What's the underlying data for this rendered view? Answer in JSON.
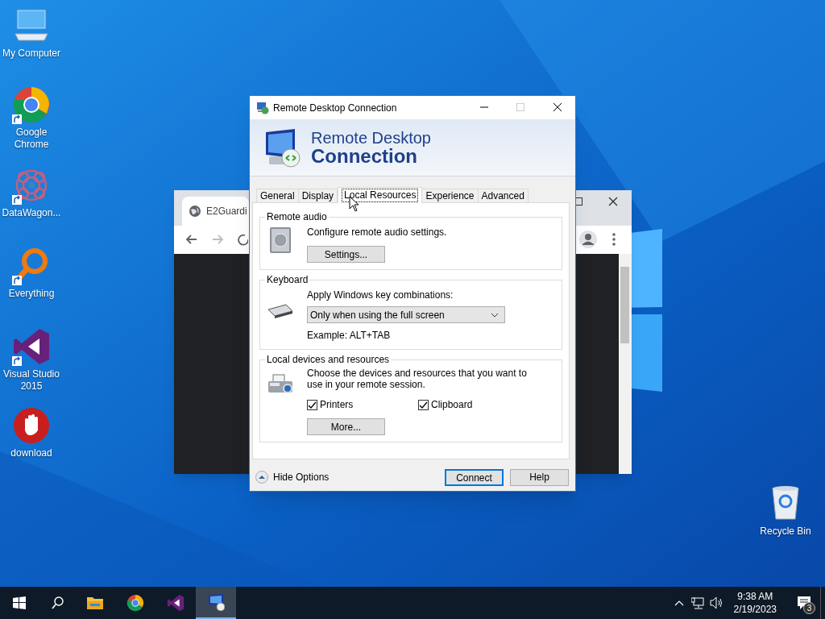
{
  "desktop_icons": [
    {
      "kind": "computer",
      "label": "My Computer",
      "shortcut": false
    },
    {
      "kind": "chrome",
      "label": "Google Chrome",
      "shortcut": true
    },
    {
      "kind": "datawagon",
      "label": "DataWagon...",
      "shortcut": true
    },
    {
      "kind": "everything",
      "label": "Everything",
      "shortcut": true
    },
    {
      "kind": "visualstudio",
      "label": "Visual Studio 2015",
      "shortcut": true
    },
    {
      "kind": "stop",
      "label": "download",
      "shortcut": false
    }
  ],
  "recycle_bin": {
    "label": "Recycle Bin"
  },
  "browser_window": {
    "tab_title": "E2Guardi"
  },
  "dialog": {
    "title": "Remote Desktop Connection",
    "banner": {
      "line_1": "Remote Desktop",
      "line_2": "Connection"
    },
    "tabs": [
      {
        "label": "General",
        "selected": false
      },
      {
        "label": "Display",
        "selected": false
      },
      {
        "label": "Local Resources",
        "selected": true
      },
      {
        "label": "Experience",
        "selected": false
      },
      {
        "label": "Advanced",
        "selected": false
      }
    ],
    "remote_audio": {
      "title": "Remote audio",
      "description": "Configure remote audio settings.",
      "button": "Settings..."
    },
    "keyboard": {
      "title": "Keyboard",
      "label": "Apply Windows key combinations:",
      "dropdown_value": "Only when using the full screen",
      "example": "Example: ALT+TAB"
    },
    "local_devices": {
      "title": "Local devices and resources",
      "description": "Choose the devices and resources that you want to use in your remote session.",
      "checkboxes": [
        {
          "label": "Printers",
          "checked": true
        },
        {
          "label": "Clipboard",
          "checked": true
        }
      ],
      "button": "More..."
    },
    "footer": {
      "toggle": "Hide Options",
      "buttons": [
        {
          "label": "Connect",
          "default": true
        },
        {
          "label": "Help",
          "default": false
        }
      ]
    }
  },
  "taskbar": {
    "apps": [
      {
        "kind": "explorer",
        "active": false
      },
      {
        "kind": "chrome",
        "active": false
      },
      {
        "kind": "visualstudio",
        "active": false
      },
      {
        "kind": "rdc",
        "active": true
      }
    ],
    "time": "9:38 AM",
    "date": "2/19/2023",
    "notification_count": "3"
  }
}
